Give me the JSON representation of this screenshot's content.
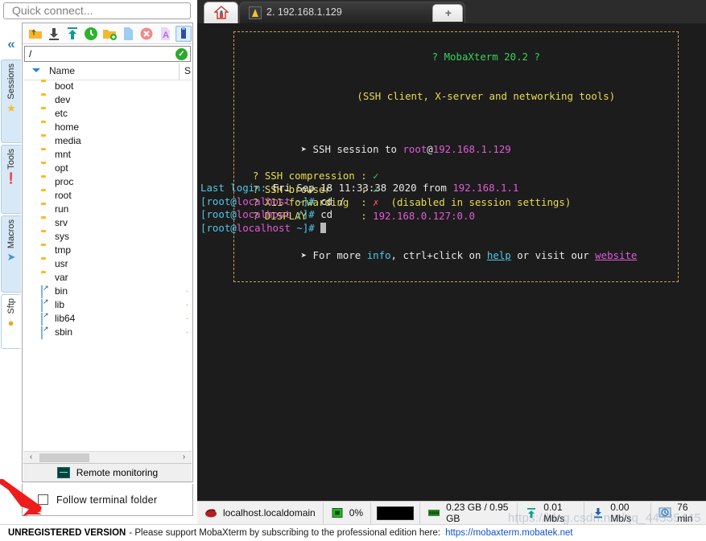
{
  "quick_connect": {
    "placeholder": "Quick connect..."
  },
  "sidebar": {
    "collapse_icon": "«",
    "tabs": [
      {
        "label": "Sessions",
        "icon": "star-icon",
        "glyph": "★",
        "color": "#f5bf2a",
        "active": false
      },
      {
        "label": "Tools",
        "icon": "tools-icon",
        "glyph": "🌡",
        "color": "#e04a3a",
        "active": false
      },
      {
        "label": "Macros",
        "icon": "macros-icon",
        "glyph": "➤",
        "color": "#4a8fd4",
        "active": false
      },
      {
        "label": "Sftp",
        "icon": "globe-icon",
        "glyph": "●",
        "color": "#f0a72c",
        "active": true
      }
    ]
  },
  "file_browser": {
    "toolbar": [
      {
        "name": "go-up-icon",
        "color": "#f5b731"
      },
      {
        "name": "download-icon",
        "color": "#4a4a4a"
      },
      {
        "name": "upload-icon",
        "color": "#0f9d8f"
      },
      {
        "name": "refresh-icon",
        "color": "#2bb32b"
      },
      {
        "name": "new-folder-icon",
        "color": "#f5b731"
      },
      {
        "name": "new-file-icon",
        "color": "#9ccdf2"
      },
      {
        "name": "delete-icon",
        "color": "#f08a8a"
      },
      {
        "name": "text-mode-icon",
        "color": "#b36fd8"
      },
      {
        "name": "usb-drive-icon",
        "color": "#2a4ca8",
        "selected": true
      }
    ],
    "path_value": "/",
    "path_confirm_icon": "check-icon",
    "columns": {
      "name": "Name",
      "size": "S"
    },
    "items": [
      {
        "label": "boot",
        "type": "folder"
      },
      {
        "label": "dev",
        "type": "folder"
      },
      {
        "label": "etc",
        "type": "folder"
      },
      {
        "label": "home",
        "type": "folder"
      },
      {
        "label": "media",
        "type": "folder"
      },
      {
        "label": "mnt",
        "type": "folder"
      },
      {
        "label": "opt",
        "type": "folder"
      },
      {
        "label": "proc",
        "type": "folder"
      },
      {
        "label": "root",
        "type": "folder"
      },
      {
        "label": "run",
        "type": "folder"
      },
      {
        "label": "srv",
        "type": "folder"
      },
      {
        "label": "sys",
        "type": "folder"
      },
      {
        "label": "tmp",
        "type": "folder"
      },
      {
        "label": "usr",
        "type": "folder"
      },
      {
        "label": "var",
        "type": "folder"
      },
      {
        "label": "bin",
        "type": "link",
        "size": "."
      },
      {
        "label": "lib",
        "type": "link",
        "size": "."
      },
      {
        "label": "lib64",
        "type": "link",
        "size": "."
      },
      {
        "label": "sbin",
        "type": "link",
        "size": "."
      }
    ],
    "scroll": {
      "left_arrow": "‹",
      "right_arrow": "›"
    },
    "remote_monitoring_label": "Remote monitoring",
    "follow_terminal_label": "Follow terminal folder",
    "follow_terminal_checked": false
  },
  "tabs": {
    "home_tab_icon": "home-icon",
    "session_tab_label": "2. 192.168.1.129",
    "session_tab_icon": "linux-icon",
    "close_icon": "×",
    "new_tab_icon": "+"
  },
  "terminal": {
    "banner": {
      "title": "? MobaXterm 20.2 ?",
      "subtitle": "(SSH client, X-server and networking tools)",
      "session_prefix": "SSH session to ",
      "session_user": "root",
      "session_at": "@",
      "session_host": "192.168.1.129",
      "rows": [
        {
          "key": "? SSH compression ",
          "sep": ": ",
          "value": "✓",
          "value_color": "green",
          "note": ""
        },
        {
          "key": "? SSH-browser     ",
          "sep": ": ",
          "value": "✓",
          "value_color": "green",
          "note": ""
        },
        {
          "key": "? X11-forwarding  ",
          "sep": ": ",
          "value": "✗",
          "value_color": "red",
          "note": "  (disabled in session settings)"
        },
        {
          "key": "? DISPLAY         ",
          "sep": ": ",
          "value": "192.168.0.127:0.0",
          "value_color": "magenta",
          "note": ""
        }
      ],
      "footer_pre": "For more ",
      "footer_info": "info",
      "footer_mid": ", ctrl+click on ",
      "footer_help": "help",
      "footer_mid2": " or visit our ",
      "footer_website": "website",
      "bullet": "➤"
    },
    "lines": [
      {
        "parts": [
          {
            "t": "Last login:",
            "c": "cyan"
          },
          {
            "t": " Fri Sep 18 11:33:38 2020 from ",
            "c": "white"
          },
          {
            "t": "192.168.1.1",
            "c": "magenta"
          }
        ]
      },
      {
        "parts": [
          {
            "t": "[root@",
            "c": "cyan"
          },
          {
            "t": "localhost",
            "c": "magenta"
          },
          {
            "t": " ~]# ",
            "c": "cyan"
          },
          {
            "t": "cd /",
            "c": "white"
          }
        ]
      },
      {
        "parts": [
          {
            "t": "[root@",
            "c": "cyan"
          },
          {
            "t": "localhost",
            "c": "magenta"
          },
          {
            "t": " /]# ",
            "c": "cyan"
          },
          {
            "t": "cd",
            "c": "white"
          }
        ]
      },
      {
        "parts": [
          {
            "t": "[root@",
            "c": "cyan"
          },
          {
            "t": "localhost",
            "c": "magenta"
          },
          {
            "t": " ~]# ",
            "c": "cyan"
          }
        ],
        "cursor": true
      }
    ]
  },
  "statusbar": {
    "host": "localhost.localdomain",
    "cpu": "0%",
    "memory": "0.23 GB / 0.95 GB",
    "upload": "0.01 Mb/s",
    "download": "0.00 Mb/s",
    "uptime": "76 min"
  },
  "footer": {
    "bold": "UNREGISTERED VERSION",
    "text": "-  Please support MobaXterm by subscribing to the professional edition here:",
    "link": "https://mobaxterm.mobatek.net"
  },
  "watermark": "https://blog.csdn.net/qq_44335445",
  "colors": {
    "accent_blue": "#3d7ebb",
    "folder_yellow": "#ffb922",
    "terminal_bg": "#1c1c1c",
    "banner_border": "#c8a060",
    "link_blue": "#1050d0"
  }
}
